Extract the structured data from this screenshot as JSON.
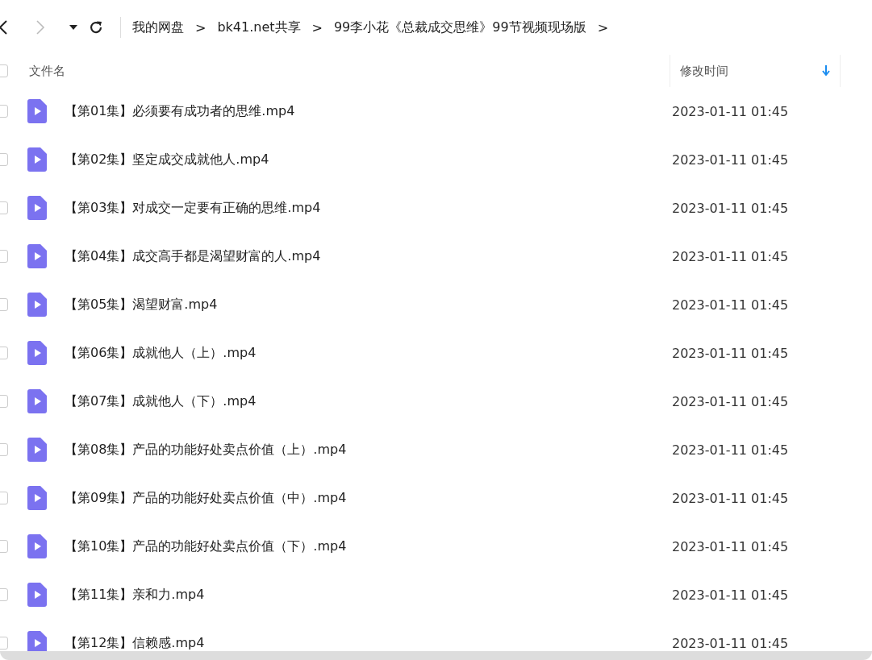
{
  "toolbar": {
    "breadcrumbs": [
      "我的网盘",
      "bk41.net共享",
      "99李小花《总裁成交思维》99节视频现场版"
    ],
    "separators": [
      ">",
      ">",
      ">"
    ]
  },
  "table": {
    "select_all_checked": false,
    "columns": [
      {
        "label": "文件名",
        "sorted": false
      },
      {
        "label": "修改时间",
        "sorted": true
      }
    ],
    "rows": [
      {
        "name": "【第01集】必须要有成功者的思维.mp4",
        "modified": "2023-01-11 01:45",
        "checked": false
      },
      {
        "name": "【第02集】坚定成交成就他人.mp4",
        "modified": "2023-01-11 01:45",
        "checked": false
      },
      {
        "name": "【第03集】对成交一定要有正确的思维.mp4",
        "modified": "2023-01-11 01:45",
        "checked": false
      },
      {
        "name": "【第04集】成交高手都是渴望财富的人.mp4",
        "modified": "2023-01-11 01:45",
        "checked": false
      },
      {
        "name": "【第05集】渴望财富.mp4",
        "modified": "2023-01-11 01:45",
        "checked": false
      },
      {
        "name": "【第06集】成就他人（上）.mp4",
        "modified": "2023-01-11 01:45",
        "checked": false
      },
      {
        "name": "【第07集】成就他人（下）.mp4",
        "modified": "2023-01-11 01:45",
        "checked": false
      },
      {
        "name": "【第08集】产品的功能好处卖点价值（上）.mp4",
        "modified": "2023-01-11 01:45",
        "checked": false
      },
      {
        "name": "【第09集】产品的功能好处卖点价值（中）.mp4",
        "modified": "2023-01-11 01:45",
        "checked": false
      },
      {
        "name": "【第10集】产品的功能好处卖点价值（下）.mp4",
        "modified": "2023-01-11 01:45",
        "checked": false
      },
      {
        "name": "【第11集】亲和力.mp4",
        "modified": "2023-01-11 01:45",
        "checked": false
      },
      {
        "name": "【第12集】信赖感.mp4",
        "modified": "2023-01-11 01:45",
        "checked": false
      }
    ]
  }
}
